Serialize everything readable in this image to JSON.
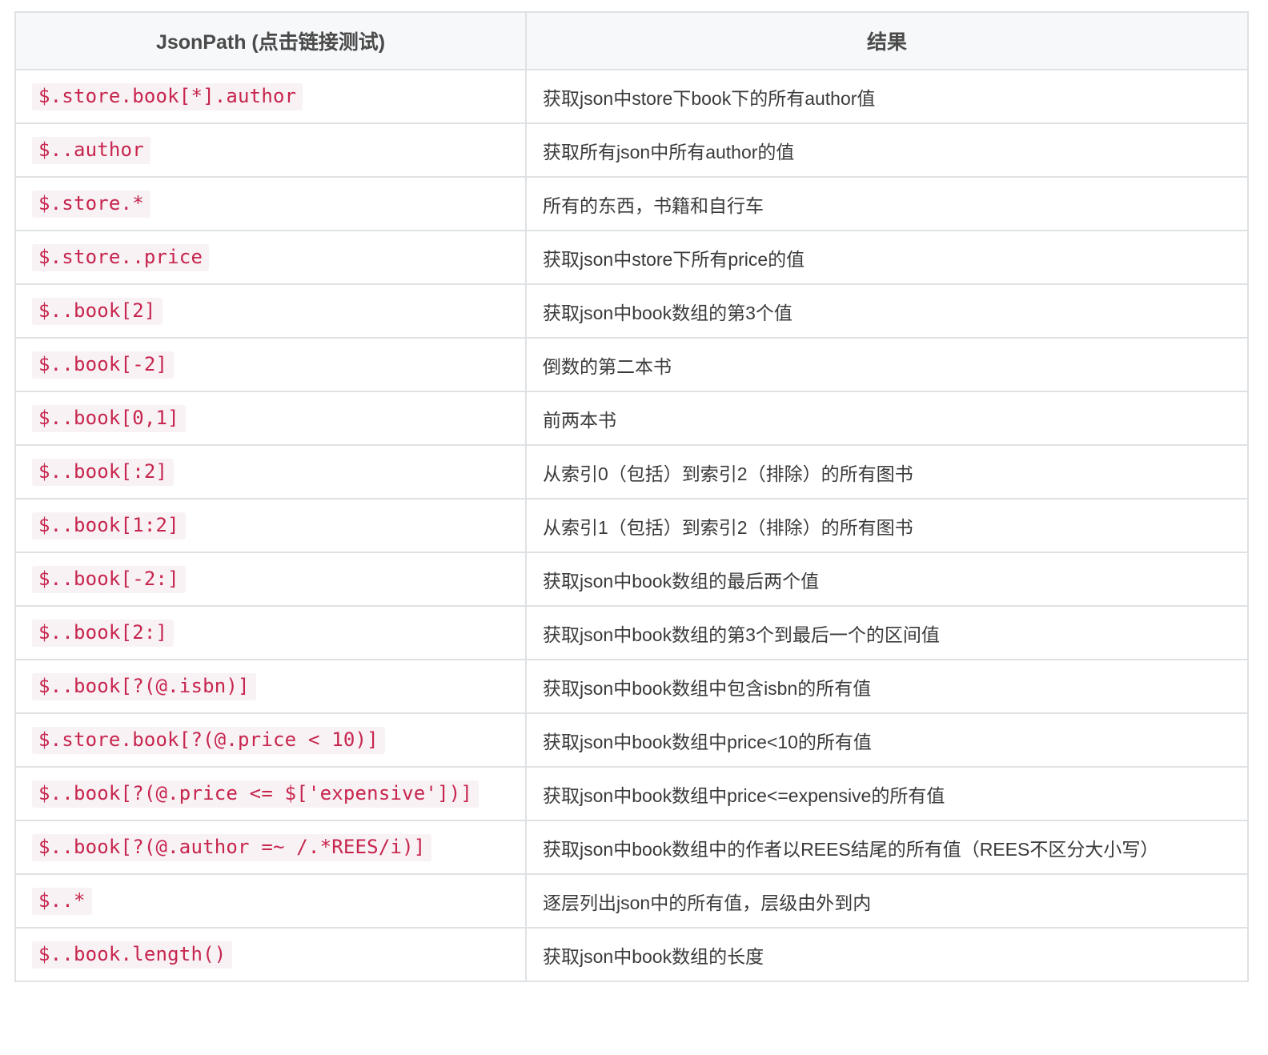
{
  "table": {
    "headers": [
      "JsonPath (点击链接测试)",
      "结果"
    ],
    "rows": [
      {
        "path": "$.store.book[*].author",
        "result": "获取json中store下book下的所有author值"
      },
      {
        "path": "$..author",
        "result": "获取所有json中所有author的值"
      },
      {
        "path": "$.store.*",
        "result": "所有的东西，书籍和自行车"
      },
      {
        "path": "$.store..price",
        "result": "获取json中store下所有price的值"
      },
      {
        "path": "$..book[2]",
        "result": "获取json中book数组的第3个值"
      },
      {
        "path": "$..book[-2]",
        "result": "倒数的第二本书"
      },
      {
        "path": "$..book[0,1]",
        "result": "前两本书"
      },
      {
        "path": "$..book[:2]",
        "result": "从索引0（包括）到索引2（排除）的所有图书"
      },
      {
        "path": "$..book[1:2]",
        "result": "从索引1（包括）到索引2（排除）的所有图书"
      },
      {
        "path": "$..book[-2:]",
        "result": "获取json中book数组的最后两个值"
      },
      {
        "path": "$..book[2:]",
        "result": "获取json中book数组的第3个到最后一个的区间值"
      },
      {
        "path": "$..book[?(@.isbn)]",
        "result": "获取json中book数组中包含isbn的所有值"
      },
      {
        "path": "$.store.book[?(@.price < 10)]",
        "result": "获取json中book数组中price<10的所有值"
      },
      {
        "path": "$..book[?(@.price <= $['expensive'])]",
        "result": "获取json中book数组中price<=expensive的所有值"
      },
      {
        "path": "$..book[?(@.author =~ /.*REES/i)]",
        "result": "获取json中book数组中的作者以REES结尾的所有值（REES不区分大小写）"
      },
      {
        "path": "$..*",
        "result": "逐层列出json中的所有值，层级由外到内"
      },
      {
        "path": "$..book.length()",
        "result": "获取json中book数组的长度"
      }
    ]
  }
}
